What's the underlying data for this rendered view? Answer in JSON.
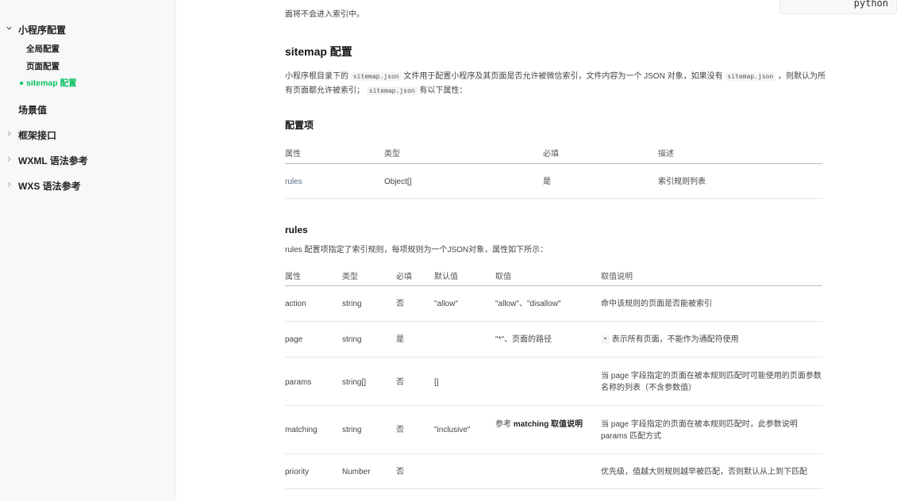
{
  "sidebar": {
    "groups": [
      {
        "label": "小程序配置",
        "expanded": true,
        "items": [
          {
            "label": "全局配置",
            "active": false
          },
          {
            "label": "页面配置",
            "active": false
          },
          {
            "label": "sitemap 配置",
            "active": true
          }
        ]
      },
      {
        "label": "场景值"
      },
      {
        "label": "框架接口"
      },
      {
        "label": "WXML 语法参考"
      },
      {
        "label": "WXS 语法参考"
      }
    ]
  },
  "header": {
    "top_text_fragment": "面将不会进入索引中。",
    "code_language": "python"
  },
  "section": {
    "title": "sitemap 配置",
    "intro_1": "小程序根目录下的",
    "intro_code_1": "sitemap.json",
    "intro_2": "文件用于配置小程序及其页面是否允许被微信索引，文件内容为一个 JSON 对象，如果没有",
    "intro_code_2": "sitemap.json",
    "intro_3": "，则默认为所",
    "intro_4": "有页面都允许被索引；",
    "intro_code_3": "sitemap.json",
    "intro_5": "有以下属性："
  },
  "config": {
    "title": "配置项",
    "headers": [
      "属性",
      "类型",
      "必填",
      "描述"
    ],
    "row": {
      "name": "rules",
      "type": "Object[]",
      "required": "是",
      "desc": "索引规则列表"
    }
  },
  "rules": {
    "title": "rules",
    "desc": "rules 配置项指定了索引规则，每项规则为一个JSON对象，属性如下所示：",
    "headers": [
      "属性",
      "类型",
      "必填",
      "默认值",
      "取值",
      "取值说明"
    ],
    "rows": [
      {
        "name": "action",
        "type": "string",
        "required": "否",
        "default": "\"allow\"",
        "value": "\"allow\"、\"disallow\"",
        "explain": "命中该规则的页面是否能被索引"
      },
      {
        "name": "page",
        "type": "string",
        "required": "是",
        "default": "",
        "value": "\"*\"、页面的路径",
        "explain_code": "*",
        "explain": "表示所有页面，不能作为通配符使用"
      },
      {
        "name": "params",
        "type": "string[]",
        "required": "否",
        "default": "[]",
        "value": "",
        "explain": "当 page 字段指定的页面在被本规则匹配时可能使用的页面参数名称的列表（不含参数值）"
      },
      {
        "name": "matching",
        "type": "string",
        "required": "否",
        "default": "\"inclusive\"",
        "value_prefix": "参考",
        "value_bold": "matching 取值说明",
        "explain": "当 page 字段指定的页面在被本规则匹配时，此参数说明 params 匹配方式"
      },
      {
        "name": "priority",
        "type": "Number",
        "required": "否",
        "default": "",
        "value": "",
        "explain": "优先级，值越大则规则越早被匹配，否则默认从上到下匹配"
      }
    ]
  }
}
